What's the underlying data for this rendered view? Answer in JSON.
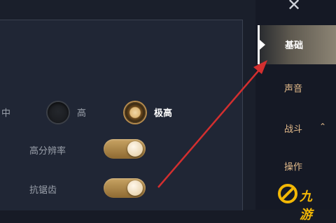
{
  "quality": {
    "options": [
      {
        "label": "中",
        "selected": false
      },
      {
        "label": "高",
        "selected": false
      },
      {
        "label": "极高",
        "selected": true
      }
    ]
  },
  "toggles": [
    {
      "label": "高分辨率",
      "enabled": true
    },
    {
      "label": "抗锯齿",
      "enabled": true
    }
  ],
  "sidebar": {
    "close_icon": "close-icon",
    "tabs": [
      {
        "label": "基础",
        "active": true
      },
      {
        "label": "声音",
        "active": false
      },
      {
        "label": "战斗",
        "active": false,
        "expandable": true
      },
      {
        "label": "操作",
        "active": false
      }
    ]
  },
  "watermark": {
    "text": "九游"
  },
  "colors": {
    "accent": "#d9b06a",
    "arrow": "#d32f2f",
    "tab_text": "#e1b98a"
  }
}
